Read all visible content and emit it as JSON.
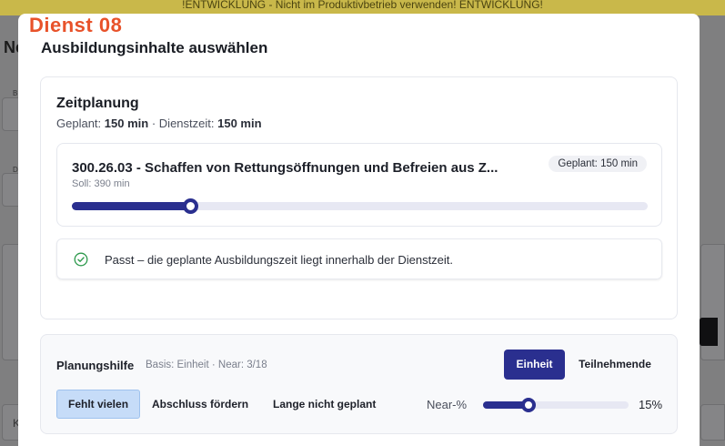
{
  "banner": {
    "text": "!ENTWICKLUNG - Nicht im Produktivbetrieb verwenden! ENTWICKLUNG!"
  },
  "env_label": "Dienst 08",
  "background": {
    "page_title_fragment": "Ne",
    "field_label_a": "B",
    "field_label_b": "D",
    "field_value_fragment": "K"
  },
  "modal": {
    "title": "Ausbildungsinhalte auswählen",
    "zeitplanung": {
      "title": "Zeitplanung",
      "geplant_label": "Geplant:",
      "geplant_value": "150 min",
      "separator": "·",
      "dienstzeit_label": "Dienstzeit:",
      "dienstzeit_value": "150 min",
      "items": [
        {
          "name": "300.26.03 - Schaffen von Rettungsöffnungen und Befreien aus Z...",
          "soll": "Soll: 390 min",
          "geplant_badge": "Geplant: 150 min",
          "progress": 0.205
        }
      ],
      "notice": "Passt – die geplante Ausbildungszeit liegt innerhalb der Dienstzeit."
    },
    "planungshilfe": {
      "title": "Planungshilfe",
      "meta": "Basis: Einheit · Near: 3/18",
      "toggle": {
        "options": [
          "Einheit",
          "Teilnehmende"
        ],
        "selected": "Einheit"
      },
      "filters": [
        "Fehlt vielen",
        "Abschluss fördern",
        "Lange nicht geplant"
      ],
      "selected_filter": "Fehlt vielen",
      "near_label": "Near-%",
      "near_value": "15%",
      "near_fraction": 0.31
    }
  },
  "colors": {
    "accent": "#2a2f8f",
    "env_label": "#e8522a",
    "banner": "#f2d85a",
    "success": "#2e9a4d"
  }
}
